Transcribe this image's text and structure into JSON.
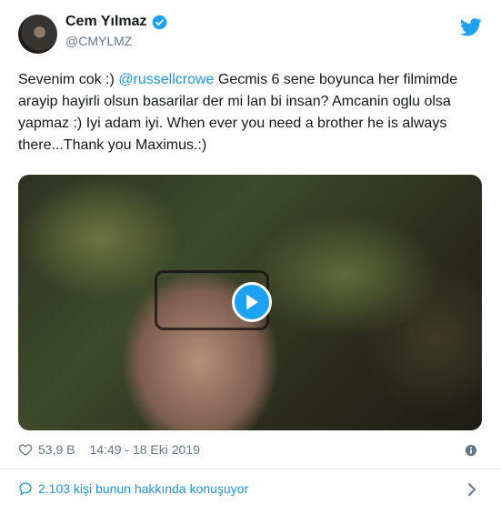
{
  "tweet": {
    "author_name": "Cem Yılmaz",
    "author_handle": "@CMYLMZ",
    "text_parts": {
      "part1": "Sevenim cok :) ",
      "mention": "@russellcrowe",
      "part2": " Gecmis 6 sene boyunca her filmimde arayip hayirli olsun basarilar der mi lan bi insan? Amcanin oglu olsa yapmaz :) Iyi adam iyi.  When ever you need a brother he is always there...Thank you Maximus.:)"
    },
    "likes": "53,9 B",
    "timestamp": "14:49 - 18 Eki 2019",
    "conversation_text": "2.103 kişi bunun hakkında konuşuyor"
  },
  "icons": {
    "verified": "verified-badge-icon",
    "brand": "twitter-bird-icon",
    "like": "heart-icon",
    "info": "info-icon",
    "reply": "speech-bubble-icon",
    "chevron": "chevron-right-icon",
    "play": "play-icon"
  },
  "colors": {
    "accent": "#1da1f2",
    "link": "#1b95e0",
    "muted": "#657786",
    "text": "#14171a"
  }
}
